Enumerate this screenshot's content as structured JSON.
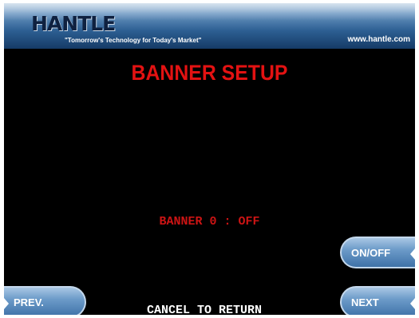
{
  "header": {
    "logo_text": "HANTLE",
    "tagline": "\"Tomorrow's Technology for Today's Market\"",
    "website": "www.hantle.com"
  },
  "screen": {
    "title": "BANNER SETUP",
    "status": "BANNER 0 : OFF",
    "footer_text": "CANCEL TO RETURN"
  },
  "buttons": {
    "on_off": "ON/OFF",
    "next": "NEXT",
    "prev": "PREV."
  },
  "colors": {
    "title": "#e31212",
    "status": "#cc1414",
    "background": "#000000",
    "button": "#6c9bc9"
  }
}
